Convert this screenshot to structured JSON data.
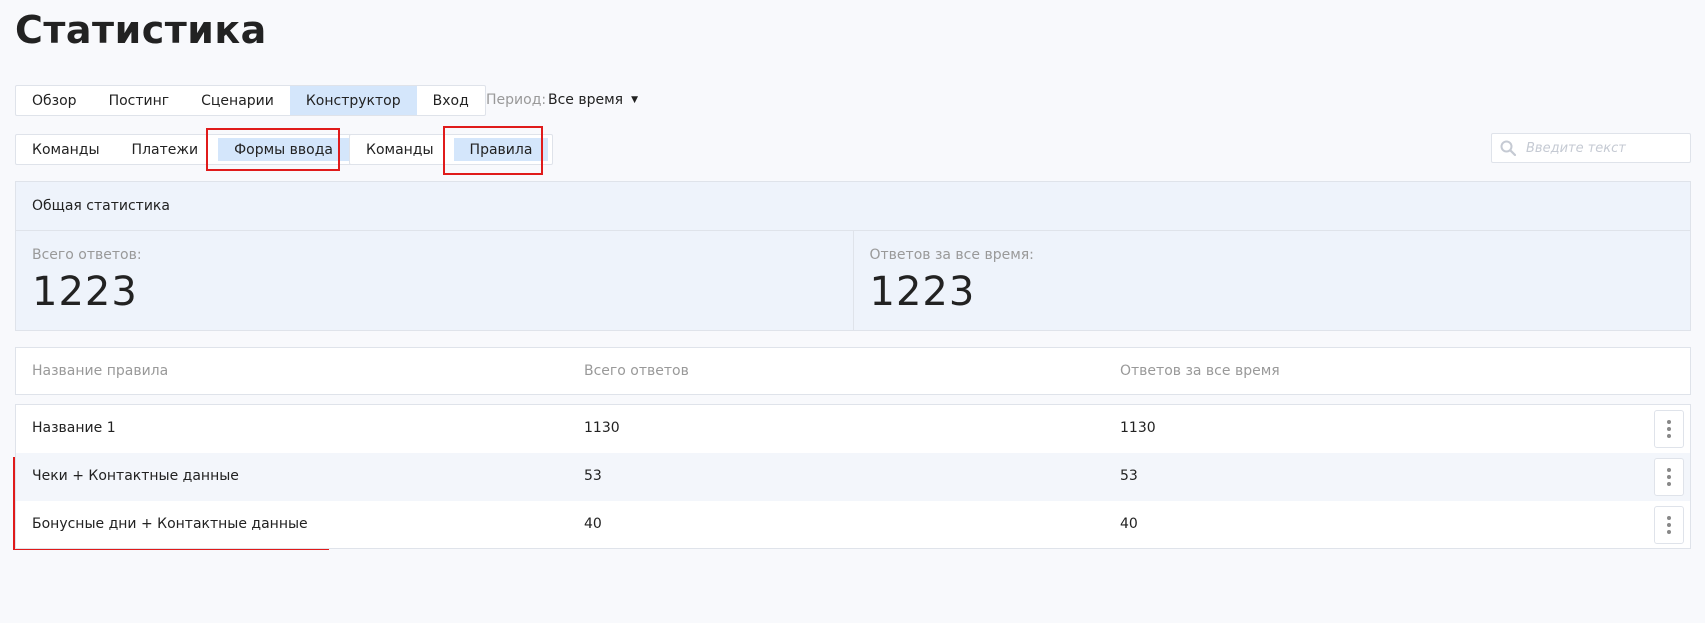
{
  "page": {
    "title": "Статистика"
  },
  "main_tabs": [
    {
      "label": "Обзор",
      "active": false
    },
    {
      "label": "Постинг",
      "active": false
    },
    {
      "label": "Сценарии",
      "active": false
    },
    {
      "label": "Конструктор",
      "active": true
    },
    {
      "label": "Вход",
      "active": false
    }
  ],
  "period": {
    "label": "Период:",
    "value": "Все время"
  },
  "sub_tabs_left": [
    {
      "label": "Команды",
      "active": false
    },
    {
      "label": "Платежи",
      "active": false
    },
    {
      "label": "Формы ввода",
      "active": true
    }
  ],
  "sub_tabs_right": [
    {
      "label": "Команды",
      "active": false
    },
    {
      "label": "Правила",
      "active": true
    }
  ],
  "search": {
    "placeholder": "Введите текст",
    "icon": "search-icon"
  },
  "stats": {
    "heading": "Общая статистика",
    "total": {
      "label": "Всего ответов:",
      "value": "1223"
    },
    "all_time": {
      "label": "Ответов за все время:",
      "value": "1223"
    }
  },
  "table": {
    "columns": [
      "Название правила",
      "Всего ответов",
      "Ответов за все время"
    ],
    "rows": [
      {
        "name": "Название 1",
        "total": "1130",
        "all_time": "1130"
      },
      {
        "name": "Чеки + Контактные данные",
        "total": "53",
        "all_time": "53"
      },
      {
        "name": "Бонусные дни + Контактные данные",
        "total": "40",
        "all_time": "40"
      }
    ]
  },
  "colors": {
    "accent_active": "#d4e6fb",
    "highlight": "#e01b1b",
    "panel": "#eef3fb"
  }
}
